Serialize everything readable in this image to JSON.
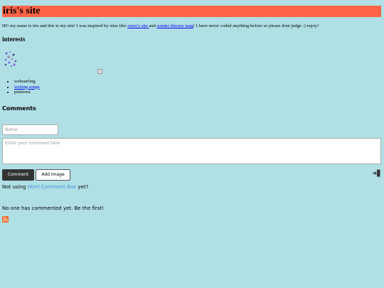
{
  "header": {
    "title": "iris's site"
  },
  "intro": {
    "text_before": "HI! my name is iris and this is my site! I was inspired by sites like ",
    "link1": "romy's site ",
    "text_middle": "and ",
    "link2": "sonder literary mag",
    "text_after": "! I have never coded anything before so please dont judge :) enjoy!"
  },
  "interests": {
    "heading": "interests",
    "items": [
      "websurfing",
      "writing songs",
      "pinterest"
    ]
  },
  "comments": {
    "heading": "Comments",
    "name_placeholder": "Name",
    "comment_placeholder": "Enter your comment here",
    "comment_button": "Comment",
    "add_image_button": "Add Image",
    "not_using_before": "Not using ",
    "not_using_link": "Html Comment Box",
    "not_using_after": "  yet?",
    "empty_message": "No one has commented yet. Be the first!"
  },
  "colors": {
    "background": "#b0e0e6",
    "header_bar": "#ff6347",
    "link": "#0000ee",
    "rss": "#f26522"
  },
  "icons": [
    "sparkle-gif-icon",
    "broken-image-icon",
    "login-icon",
    "rss-icon"
  ]
}
